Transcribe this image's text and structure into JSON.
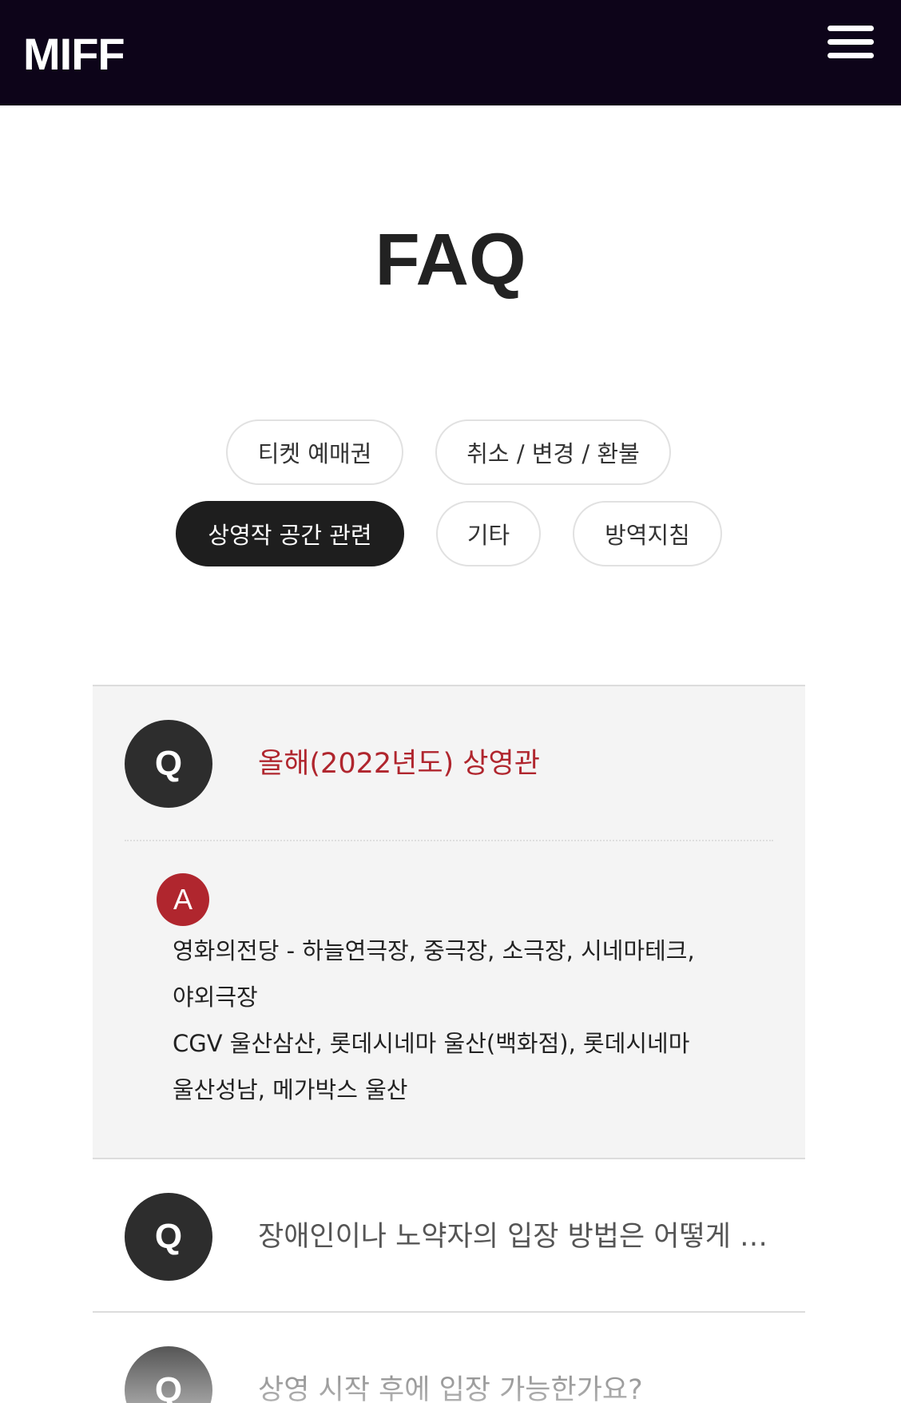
{
  "header": {
    "logo": "MIFF",
    "menu_icon": "hamburger-menu-icon"
  },
  "page": {
    "title": "FAQ"
  },
  "tabs": [
    {
      "label": "티켓 예매권",
      "active": false
    },
    {
      "label": "취소 / 변경 / 환불",
      "active": false
    },
    {
      "label": "상영작 공간 관련",
      "active": true
    },
    {
      "label": "기타",
      "active": false
    },
    {
      "label": "방역지침",
      "active": false
    }
  ],
  "faq": {
    "q_marker": "Q",
    "a_marker": "A",
    "items": [
      {
        "question": "올해(2022년도) 상영관",
        "expanded": true,
        "answer_lines": [
          "영화의전당 - 하늘연극장, 중극장, 소극장, 시네마테크,",
          "야외극장",
          "CGV 울산삼산, 롯데시네마 울산(백화점), 롯데시네마",
          "울산성남, 메가박스 울산"
        ]
      },
      {
        "question": "장애인이나 노약자의 입장 방법은 어떻게 되나요?",
        "expanded": false
      },
      {
        "question": "상영 시작 후에 입장 가능한가요?",
        "expanded": false
      }
    ]
  },
  "colors": {
    "header_bg": "#0d0419",
    "accent_red": "#b0262e",
    "active_tab_bg": "#1e1e1e",
    "q_badge_bg": "#2d2d2d",
    "open_item_bg": "#f4f4f4"
  }
}
